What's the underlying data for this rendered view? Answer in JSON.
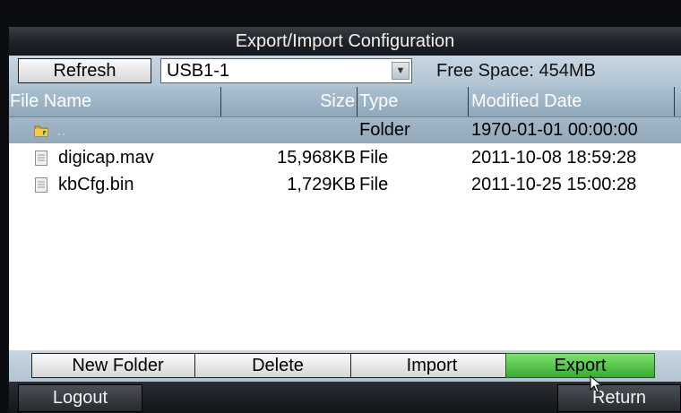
{
  "title": "Export/Import Configuration",
  "toolbar": {
    "refresh_label": "Refresh",
    "device_value": "USB1-1",
    "free_space": "Free Space: 454MB"
  },
  "table": {
    "headers": [
      "File Name",
      "Size",
      "Type",
      "Modified Date"
    ],
    "rows": [
      {
        "icon": "folder-icon",
        "name": "..",
        "size": "",
        "type": "Folder",
        "date": "1970-01-01 00:00:00"
      },
      {
        "icon": "file-icon",
        "name": "digicap.mav",
        "size": "15,968KB",
        "type": "File",
        "date": "2011-10-08 18:59:28"
      },
      {
        "icon": "file-icon",
        "name": "kbCfg.bin",
        "size": "1,729KB",
        "type": "File",
        "date": "2011-10-25 15:00:28"
      }
    ],
    "selected_row": 0
  },
  "actions": {
    "new_folder": "New Folder",
    "delete": "Delete",
    "import": "Import",
    "export": "Export"
  },
  "footer": {
    "logout": "Logout",
    "return": "Return"
  },
  "colors": {
    "toolbar_bg": "#b8c9d7",
    "header_bg": "#9cb3c5",
    "export_green": "#4cc03f",
    "title_bg": "#1e2126"
  }
}
